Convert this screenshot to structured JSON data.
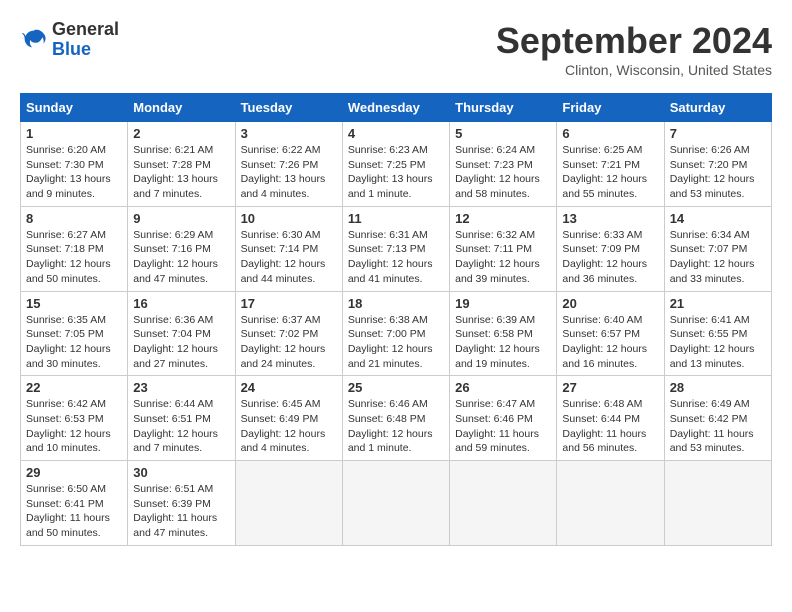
{
  "header": {
    "logo_line1": "General",
    "logo_line2": "Blue",
    "month": "September 2024",
    "location": "Clinton, Wisconsin, United States"
  },
  "days_of_week": [
    "Sunday",
    "Monday",
    "Tuesday",
    "Wednesday",
    "Thursday",
    "Friday",
    "Saturday"
  ],
  "weeks": [
    [
      {
        "day": "1",
        "sunrise": "6:20 AM",
        "sunset": "7:30 PM",
        "daylight": "13 hours and 9 minutes."
      },
      {
        "day": "2",
        "sunrise": "6:21 AM",
        "sunset": "7:28 PM",
        "daylight": "13 hours and 7 minutes."
      },
      {
        "day": "3",
        "sunrise": "6:22 AM",
        "sunset": "7:26 PM",
        "daylight": "13 hours and 4 minutes."
      },
      {
        "day": "4",
        "sunrise": "6:23 AM",
        "sunset": "7:25 PM",
        "daylight": "13 hours and 1 minute."
      },
      {
        "day": "5",
        "sunrise": "6:24 AM",
        "sunset": "7:23 PM",
        "daylight": "12 hours and 58 minutes."
      },
      {
        "day": "6",
        "sunrise": "6:25 AM",
        "sunset": "7:21 PM",
        "daylight": "12 hours and 55 minutes."
      },
      {
        "day": "7",
        "sunrise": "6:26 AM",
        "sunset": "7:20 PM",
        "daylight": "12 hours and 53 minutes."
      }
    ],
    [
      {
        "day": "8",
        "sunrise": "6:27 AM",
        "sunset": "7:18 PM",
        "daylight": "12 hours and 50 minutes."
      },
      {
        "day": "9",
        "sunrise": "6:29 AM",
        "sunset": "7:16 PM",
        "daylight": "12 hours and 47 minutes."
      },
      {
        "day": "10",
        "sunrise": "6:30 AM",
        "sunset": "7:14 PM",
        "daylight": "12 hours and 44 minutes."
      },
      {
        "day": "11",
        "sunrise": "6:31 AM",
        "sunset": "7:13 PM",
        "daylight": "12 hours and 41 minutes."
      },
      {
        "day": "12",
        "sunrise": "6:32 AM",
        "sunset": "7:11 PM",
        "daylight": "12 hours and 39 minutes."
      },
      {
        "day": "13",
        "sunrise": "6:33 AM",
        "sunset": "7:09 PM",
        "daylight": "12 hours and 36 minutes."
      },
      {
        "day": "14",
        "sunrise": "6:34 AM",
        "sunset": "7:07 PM",
        "daylight": "12 hours and 33 minutes."
      }
    ],
    [
      {
        "day": "15",
        "sunrise": "6:35 AM",
        "sunset": "7:05 PM",
        "daylight": "12 hours and 30 minutes."
      },
      {
        "day": "16",
        "sunrise": "6:36 AM",
        "sunset": "7:04 PM",
        "daylight": "12 hours and 27 minutes."
      },
      {
        "day": "17",
        "sunrise": "6:37 AM",
        "sunset": "7:02 PM",
        "daylight": "12 hours and 24 minutes."
      },
      {
        "day": "18",
        "sunrise": "6:38 AM",
        "sunset": "7:00 PM",
        "daylight": "12 hours and 21 minutes."
      },
      {
        "day": "19",
        "sunrise": "6:39 AM",
        "sunset": "6:58 PM",
        "daylight": "12 hours and 19 minutes."
      },
      {
        "day": "20",
        "sunrise": "6:40 AM",
        "sunset": "6:57 PM",
        "daylight": "12 hours and 16 minutes."
      },
      {
        "day": "21",
        "sunrise": "6:41 AM",
        "sunset": "6:55 PM",
        "daylight": "12 hours and 13 minutes."
      }
    ],
    [
      {
        "day": "22",
        "sunrise": "6:42 AM",
        "sunset": "6:53 PM",
        "daylight": "12 hours and 10 minutes."
      },
      {
        "day": "23",
        "sunrise": "6:44 AM",
        "sunset": "6:51 PM",
        "daylight": "12 hours and 7 minutes."
      },
      {
        "day": "24",
        "sunrise": "6:45 AM",
        "sunset": "6:49 PM",
        "daylight": "12 hours and 4 minutes."
      },
      {
        "day": "25",
        "sunrise": "6:46 AM",
        "sunset": "6:48 PM",
        "daylight": "12 hours and 1 minute."
      },
      {
        "day": "26",
        "sunrise": "6:47 AM",
        "sunset": "6:46 PM",
        "daylight": "11 hours and 59 minutes."
      },
      {
        "day": "27",
        "sunrise": "6:48 AM",
        "sunset": "6:44 PM",
        "daylight": "11 hours and 56 minutes."
      },
      {
        "day": "28",
        "sunrise": "6:49 AM",
        "sunset": "6:42 PM",
        "daylight": "11 hours and 53 minutes."
      }
    ],
    [
      {
        "day": "29",
        "sunrise": "6:50 AM",
        "sunset": "6:41 PM",
        "daylight": "11 hours and 50 minutes."
      },
      {
        "day": "30",
        "sunrise": "6:51 AM",
        "sunset": "6:39 PM",
        "daylight": "11 hours and 47 minutes."
      },
      null,
      null,
      null,
      null,
      null
    ]
  ]
}
